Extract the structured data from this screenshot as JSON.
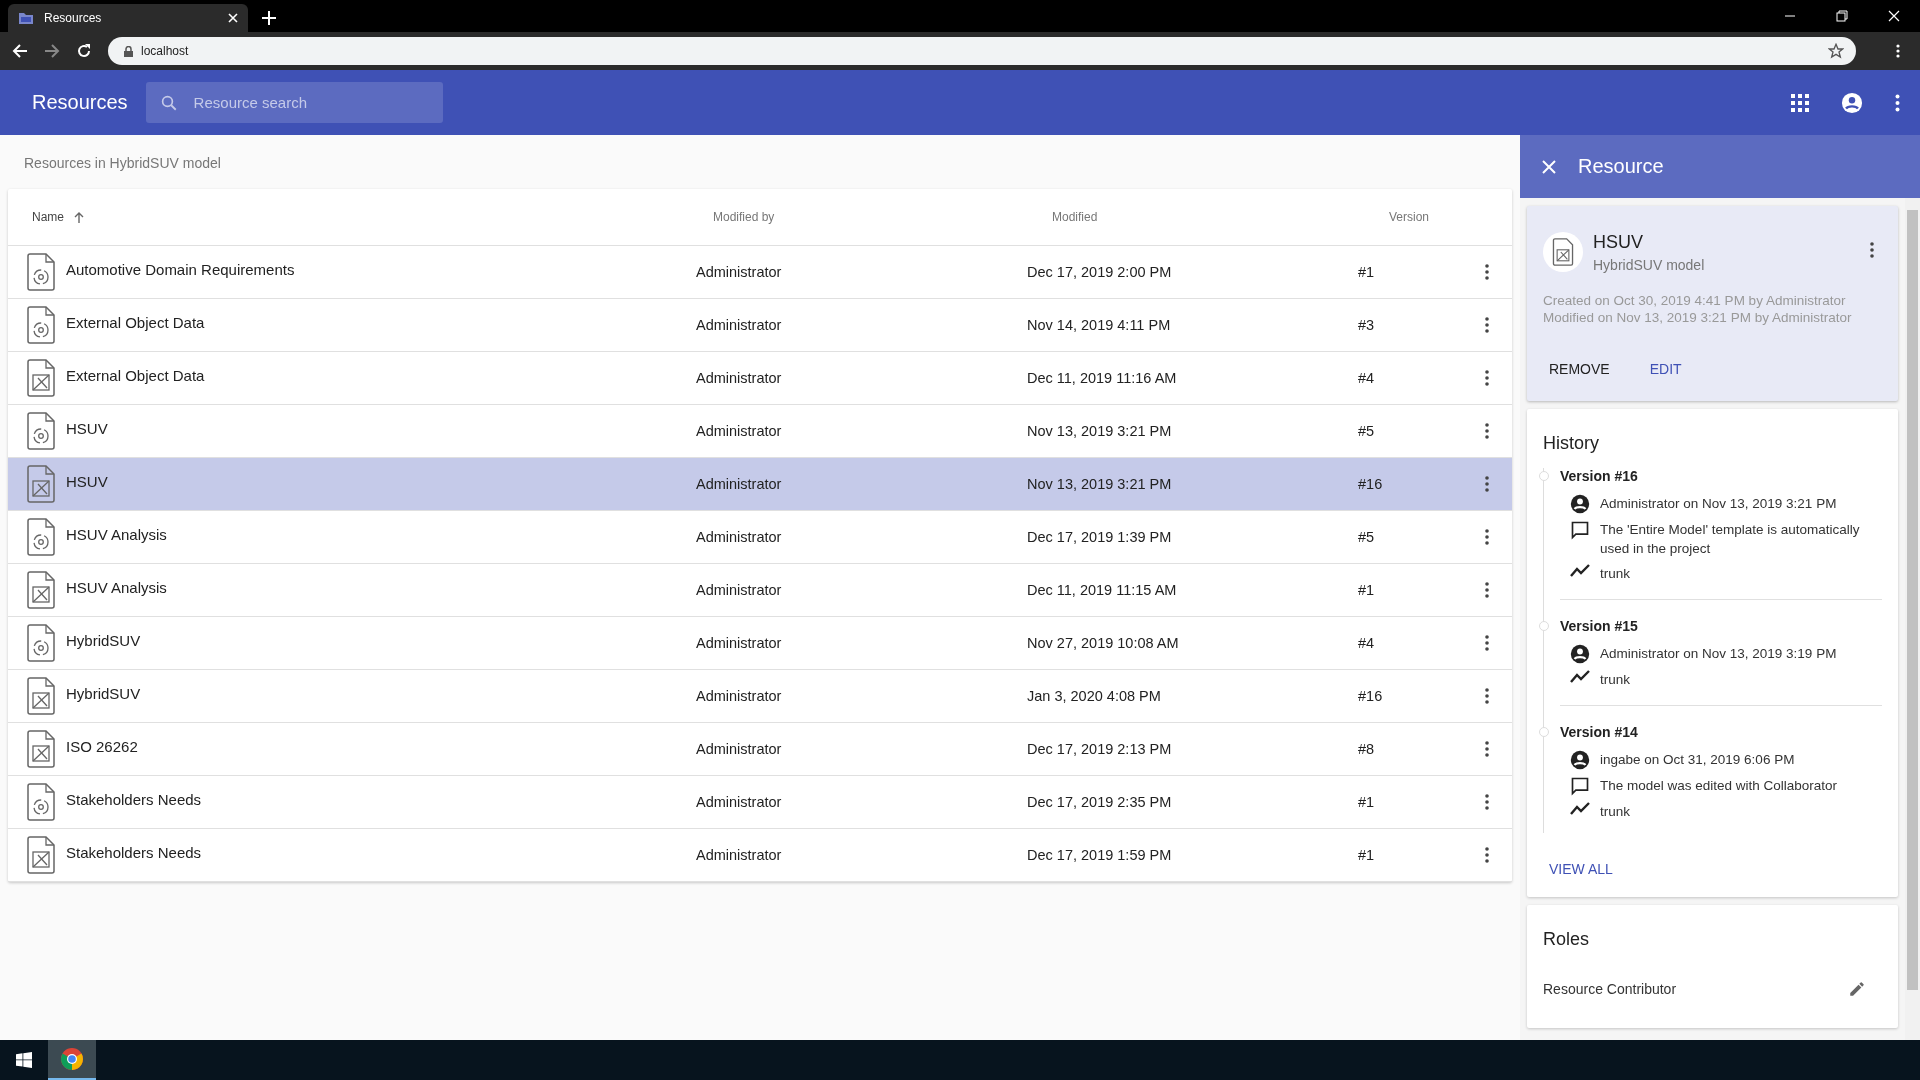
{
  "browser": {
    "tab_title": "Resources",
    "address": "localhost"
  },
  "app_bar": {
    "title": "Resources",
    "search": {
      "placeholder": "Resource search"
    }
  },
  "breadcrumb": "Resources in HybridSUV model",
  "table": {
    "columns": [
      {
        "label": "Name",
        "sorted": true
      },
      {
        "label": "Modified by",
        "sorted": false
      },
      {
        "label": "Modified",
        "sorted": false
      },
      {
        "label": "Version",
        "sorted": false
      }
    ],
    "rows": [
      {
        "kind": "model",
        "name": "Automotive Domain Requirements",
        "modified_by": "Administrator",
        "modified": "Dec 17, 2019 2:00 PM",
        "version": "#1",
        "selected": false
      },
      {
        "kind": "model",
        "name": "External Object Data",
        "modified_by": "Administrator",
        "modified": "Nov 14, 2019 4:11 PM",
        "version": "#3",
        "selected": false
      },
      {
        "kind": "diagram",
        "name": "External Object Data",
        "modified_by": "Administrator",
        "modified": "Dec 11, 2019 11:16 AM",
        "version": "#4",
        "selected": false
      },
      {
        "kind": "model",
        "name": "HSUV",
        "modified_by": "Administrator",
        "modified": "Nov 13, 2019 3:21 PM",
        "version": "#5",
        "selected": false
      },
      {
        "kind": "diagram",
        "name": "HSUV",
        "modified_by": "Administrator",
        "modified": "Nov 13, 2019 3:21 PM",
        "version": "#16",
        "selected": true
      },
      {
        "kind": "model",
        "name": "HSUV Analysis",
        "modified_by": "Administrator",
        "modified": "Dec 17, 2019 1:39 PM",
        "version": "#5",
        "selected": false
      },
      {
        "kind": "diagram",
        "name": "HSUV Analysis",
        "modified_by": "Administrator",
        "modified": "Dec 11, 2019 11:15 AM",
        "version": "#1",
        "selected": false
      },
      {
        "kind": "model",
        "name": "HybridSUV",
        "modified_by": "Administrator",
        "modified": "Nov 27, 2019 10:08 AM",
        "version": "#4",
        "selected": false
      },
      {
        "kind": "diagram",
        "name": "HybridSUV",
        "modified_by": "Administrator",
        "modified": "Jan 3, 2020 4:08 PM",
        "version": "#16",
        "selected": false
      },
      {
        "kind": "diagram",
        "name": "ISO 26262",
        "modified_by": "Administrator",
        "modified": "Dec 17, 2019 2:13 PM",
        "version": "#8",
        "selected": false
      },
      {
        "kind": "model",
        "name": "Stakeholders Needs",
        "modified_by": "Administrator",
        "modified": "Dec 17, 2019 2:35 PM",
        "version": "#1",
        "selected": false
      },
      {
        "kind": "diagram",
        "name": "Stakeholders Needs",
        "modified_by": "Administrator",
        "modified": "Dec 17, 2019 1:59 PM",
        "version": "#1",
        "selected": false
      }
    ]
  },
  "panel": {
    "title": "Resource",
    "resource": {
      "kind": "diagram",
      "name": "HSUV",
      "model": "HybridSUV model",
      "created": "Created on Oct 30, 2019 4:41 PM by Administrator",
      "modified": "Modified on Nov 13, 2019 3:21 PM by Administrator",
      "actions": [
        "REMOVE",
        "EDIT"
      ]
    },
    "history": {
      "title": "History",
      "versions": [
        {
          "label": "Version #16",
          "details": [
            {
              "kind": "user",
              "text": "Administrator on Nov 13, 2019 3:21 PM"
            },
            {
              "kind": "comment",
              "text": "The 'Entire Model' template is automatically used in the project"
            },
            {
              "kind": "branch",
              "text": "trunk"
            }
          ]
        },
        {
          "label": "Version #15",
          "details": [
            {
              "kind": "user",
              "text": "Administrator on Nov 13, 2019 3:19 PM"
            },
            {
              "kind": "branch",
              "text": "trunk"
            }
          ]
        },
        {
          "label": "Version #14",
          "details": [
            {
              "kind": "user",
              "text": "ingabe on Oct 31, 2019 6:06 PM"
            },
            {
              "kind": "comment",
              "text": "The model was edited with Collaborator"
            },
            {
              "kind": "branch",
              "text": "trunk"
            }
          ]
        }
      ],
      "view_all": "VIEW ALL"
    },
    "roles": {
      "title": "Roles",
      "items": [
        "Resource Contributor"
      ]
    }
  }
}
